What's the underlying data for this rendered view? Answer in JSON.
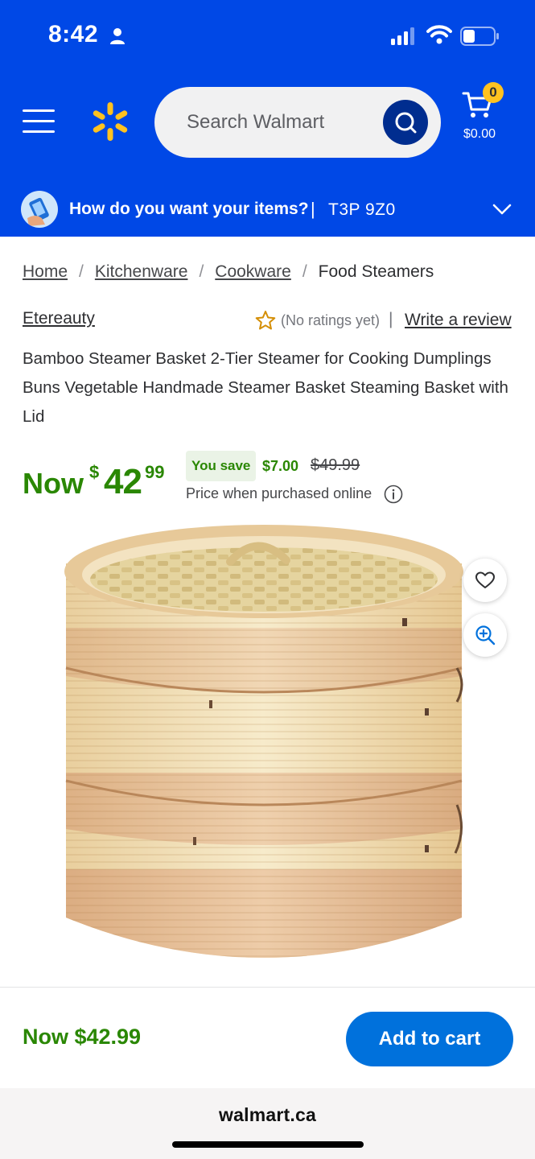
{
  "status_bar": {
    "time": "8:42"
  },
  "header": {
    "search_placeholder": "Search Walmart",
    "cart_count": "0",
    "cart_amount": "$0.00",
    "brand_color": "#0048e6",
    "spark_color": "#ffc220"
  },
  "delivery": {
    "question": "How do you want your items?",
    "separator": "|",
    "postal_code": "T3P 9Z0"
  },
  "breadcrumb": {
    "items": [
      "Home",
      "Kitchenware",
      "Cookware"
    ],
    "separator": "/",
    "current": "Food Steamers"
  },
  "product": {
    "brand": "Etereauty",
    "ratings_text": "(No ratings yet)",
    "ratings_separator": "|",
    "write_review": "Write a review",
    "title": "Bamboo Steamer Basket 2-Tier Steamer for Cooking Dumplings Buns Vegetable Handmade Steamer Basket Steaming Basket with Lid"
  },
  "price": {
    "now_label": "Now",
    "currency": "$",
    "whole": "42",
    "cents": "99",
    "you_save_label": "You save",
    "save_amount": "$7.00",
    "was_price": "$49.99",
    "note": "Price when purchased online",
    "price_color": "#2a8703"
  },
  "sticky": {
    "price_text": "Now $42.99",
    "add_to_cart": "Add to cart",
    "button_color": "#0071dc"
  },
  "browser": {
    "url": "walmart.ca"
  },
  "icons": [
    "person-icon",
    "signal-icon",
    "wifi-icon",
    "battery-icon",
    "menu-icon",
    "spark-logo-icon",
    "search-icon",
    "cart-icon",
    "delivery-icon",
    "chevron-down-icon",
    "star-icon",
    "info-icon",
    "heart-icon",
    "zoom-in-icon"
  ]
}
